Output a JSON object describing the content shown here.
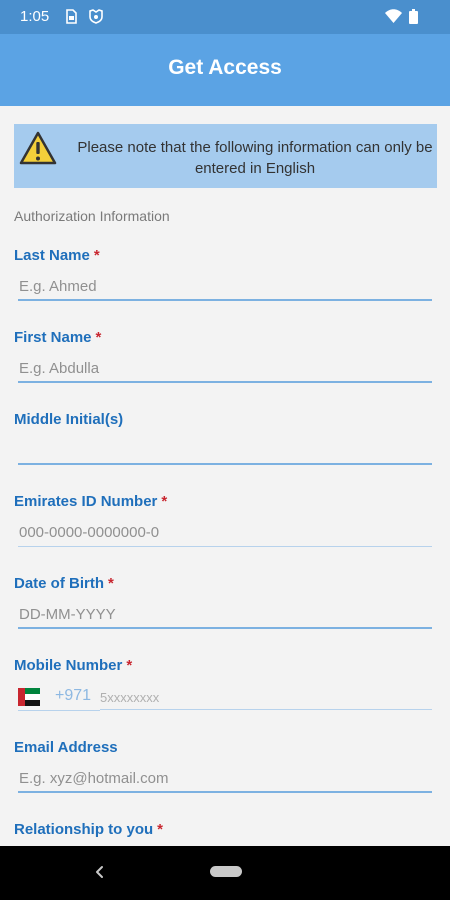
{
  "status_bar": {
    "time": "1:05",
    "icons": [
      "sim-card-icon",
      "shield-icon",
      "wifi-icon",
      "battery-icon"
    ]
  },
  "app_bar": {
    "title": "Get Access"
  },
  "notice": {
    "icon": "warning-icon",
    "text": "Please note that the following information can only be entered in English"
  },
  "section": {
    "title": "Authorization Information"
  },
  "fields": {
    "last_name": {
      "label": "Last Name",
      "required": "*",
      "placeholder": "E.g. Ahmed",
      "value": ""
    },
    "first_name": {
      "label": "First Name",
      "required": "*",
      "placeholder": "E.g. Abdulla",
      "value": ""
    },
    "middle_initials": {
      "label": "Middle Initial(s)",
      "placeholder": "",
      "value": ""
    },
    "emirates_id": {
      "label": "Emirates ID Number",
      "required": "*",
      "placeholder": "000-0000-0000000-0",
      "value": ""
    },
    "date_of_birth": {
      "label": "Date of Birth",
      "required": "*",
      "placeholder": "DD-MM-YYYY",
      "value": ""
    },
    "mobile": {
      "label": "Mobile Number",
      "required": "*",
      "country_code": "+971",
      "placeholder": "5xxxxxxxx",
      "value": "",
      "flag": "uae-flag-icon"
    },
    "email": {
      "label": "Email Address",
      "placeholder": "E.g. xyz@hotmail.com",
      "value": ""
    },
    "relationship": {
      "label": "Relationship to you",
      "required": "*"
    }
  },
  "colors": {
    "status_bar": "#4a8fcd",
    "app_bar": "#5ba3e4",
    "notice_bg": "#a5cbee",
    "label": "#1f6fbb",
    "required": "#c8262f",
    "underline": "#7cb1e1",
    "background": "#f3f3f3"
  },
  "nav_bar": {
    "icons": [
      "back-icon",
      "home-pill-icon"
    ]
  }
}
